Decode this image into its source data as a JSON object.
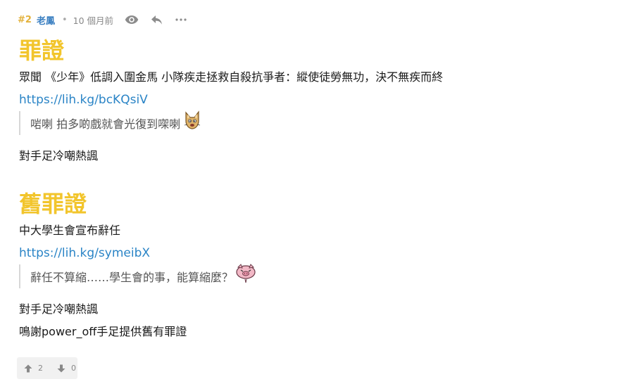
{
  "post": {
    "floor": "#2",
    "author": "老鳳",
    "separator": "•",
    "time": "10 個月前",
    "icons": {
      "view": "eye-icon",
      "reply": "reply-icon",
      "more": "more-icon"
    }
  },
  "content": {
    "section1": {
      "title": "罪證",
      "headline": "眾聞 《少年》低調入圍金馬 小隊疾走拯救自殺抗爭者：縱使徒勞無功，決不無疾而終",
      "link": "https://lih.kg/bcKQsiV",
      "quote": "啱喇 拍多啲戲就會光復到㗎喇",
      "sticker": "fox-emoji",
      "comment": "對手足冷嘲熱諷"
    },
    "section2": {
      "title": "舊罪證",
      "headline": "中大學生會宣布辭任",
      "link": "https://lih.kg/symeibX",
      "quote": "辭任不算縮……學生會的事，能算縮麼？",
      "sticker": "pig-emoji",
      "comment": "對手足冷嘲熱諷",
      "thanks": "鳴謝power_off手足提供舊有罪證"
    }
  },
  "votes": {
    "up_count": "2",
    "down_count": "0"
  },
  "colors": {
    "floor": "#e3b23c",
    "author": "#3a7fc1",
    "title": "#f2c52c",
    "link": "#2a84c6"
  }
}
